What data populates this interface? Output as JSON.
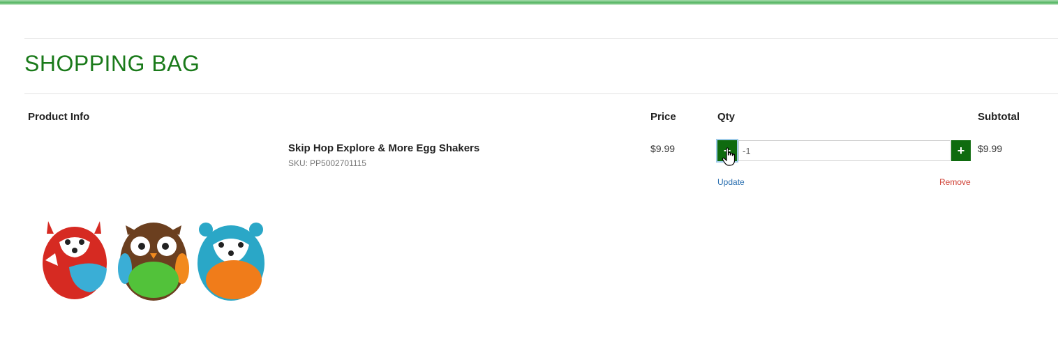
{
  "page": {
    "title": "SHOPPING BAG"
  },
  "table": {
    "headers": {
      "product_info": "Product Info",
      "price": "Price",
      "qty": "Qty",
      "subtotal": "Subtotal"
    }
  },
  "cart_item": {
    "name": "Skip Hop Explore & More Egg Shakers",
    "sku_label": "SKU:",
    "sku": "PP5002701115",
    "price": "$9.99",
    "qty_value": "-1",
    "minus_label": "−",
    "plus_label": "+",
    "subtotal": "$9.99",
    "update_label": "Update",
    "remove_label": "Remove",
    "image_icon": "egg-shakers-fox-owl-hedgehog"
  },
  "colors": {
    "accent_green": "#0f6b0f",
    "title_green": "#1a7a1a",
    "link_blue": "#2a6fb0",
    "remove_red": "#d0453a"
  }
}
